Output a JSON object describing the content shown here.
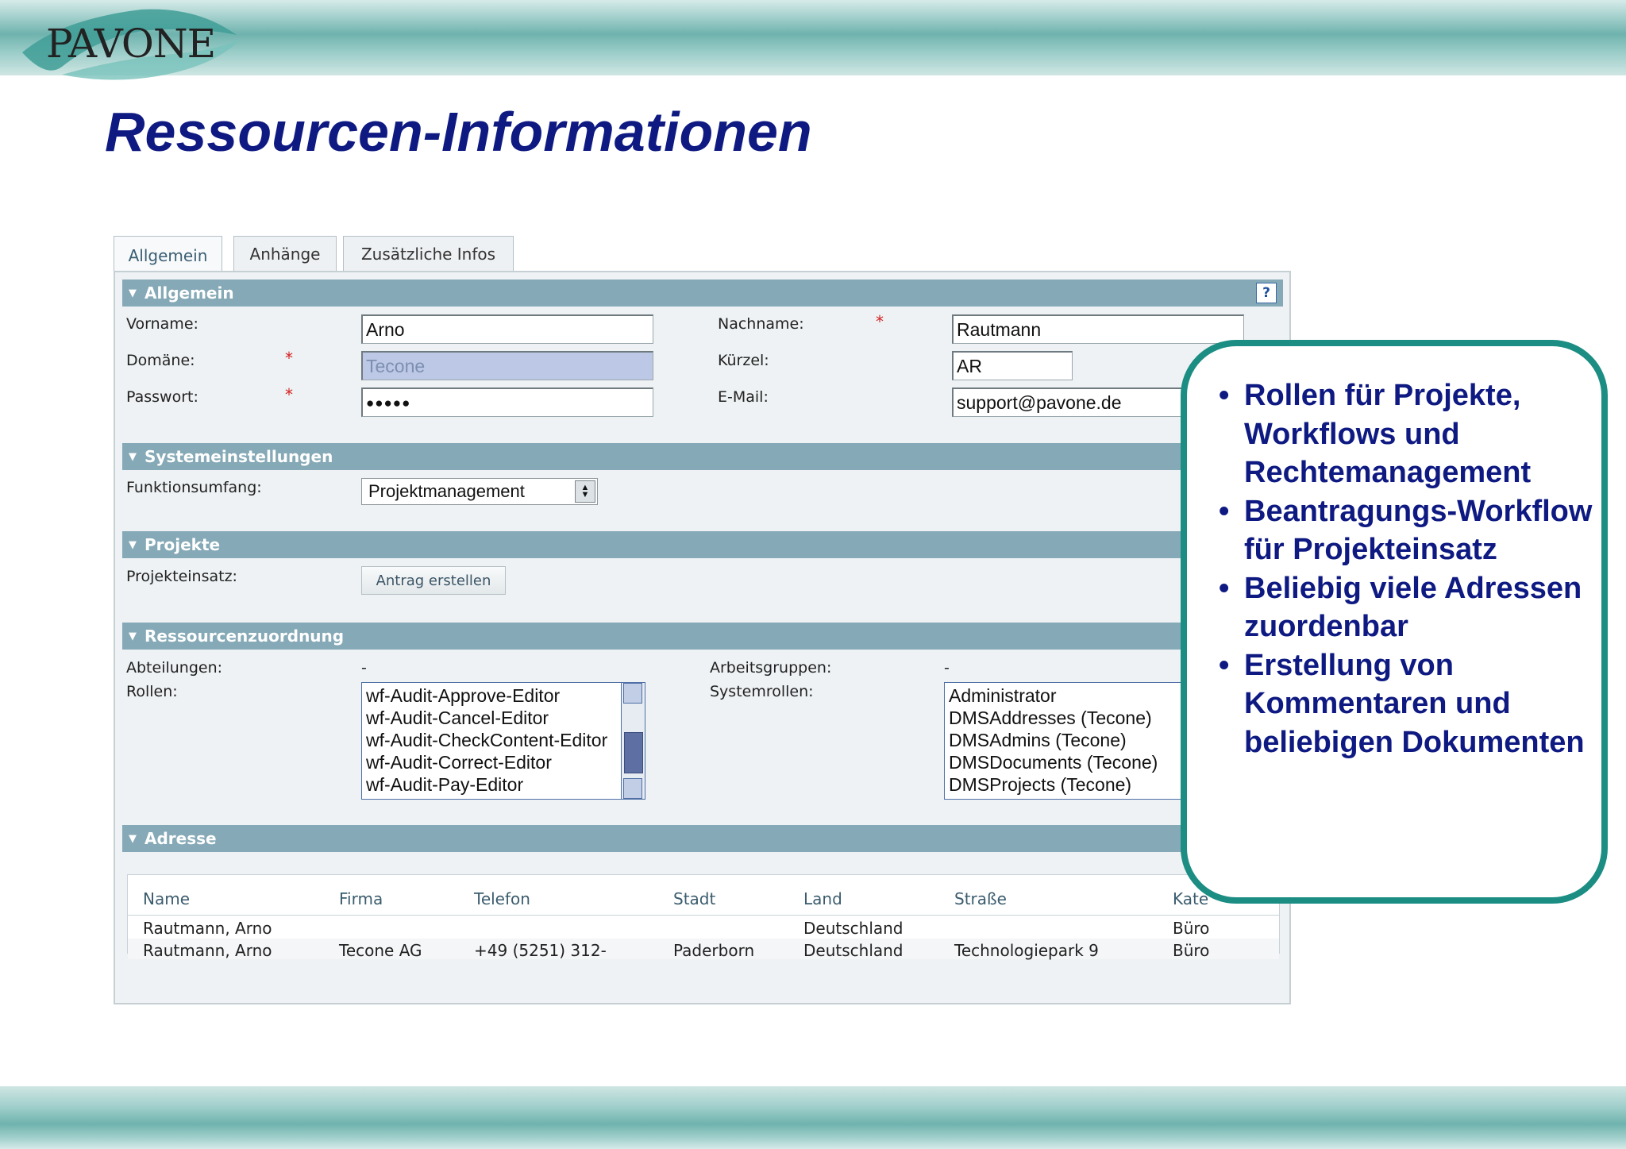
{
  "slide": {
    "logo_text": "PAVONE",
    "title": "Ressourcen-Informationen"
  },
  "tabs": [
    "Allgemein",
    "Anhänge",
    "Zusätzliche Infos"
  ],
  "help_label": "?",
  "sections": {
    "allgemein": "Allgemein",
    "system": "Systemeinstellungen",
    "projekte": "Projekte",
    "ressourcen": "Ressourcenzuordnung",
    "adresse": "Adresse"
  },
  "required_marker": "*",
  "fields": {
    "vorname": {
      "label": "Vorname:",
      "value": "Arno"
    },
    "nachname": {
      "label": "Nachname:",
      "value": "Rautmann"
    },
    "domaene": {
      "label": "Domäne:",
      "value": "Tecone"
    },
    "kuerzel": {
      "label": "Kürzel:",
      "value": "AR"
    },
    "passwort": {
      "label": "Passwort:",
      "value": "●●●●●"
    },
    "email": {
      "label": "E-Mail:",
      "value": "support@pavone.de"
    },
    "funktionsumfang": {
      "label": "Funktionsumfang:",
      "value": "Projektmanagement"
    },
    "projekteinsatz": {
      "label": "Projekteinsatz:",
      "button": "Antrag erstellen"
    },
    "abteilungen": {
      "label": "Abteilungen:",
      "value": "-"
    },
    "arbeitsgruppen": {
      "label": "Arbeitsgruppen:",
      "value": "-"
    },
    "rollen": {
      "label": "Rollen:"
    },
    "systemrollen": {
      "label": "Systemrollen:"
    }
  },
  "rollen_list": [
    "wf-Audit-Approve-Editor",
    "wf-Audit-Cancel-Editor",
    "wf-Audit-CheckContent-Editor",
    "wf-Audit-Correct-Editor",
    "wf-Audit-Pay-Editor"
  ],
  "systemrollen_list": [
    "Administrator",
    "DMSAddresses (Tecone)",
    "DMSAdmins (Tecone)",
    "DMSDocuments (Tecone)",
    "DMSProjects (Tecone)"
  ],
  "address_table": {
    "columns": [
      "Name",
      "Firma",
      "Telefon",
      "Stadt",
      "Land",
      "Straße",
      "Kate"
    ],
    "rows": [
      [
        "Rautmann, Arno",
        "",
        "",
        "",
        "Deutschland",
        "",
        "Büro"
      ],
      [
        "Rautmann, Arno",
        "Tecone AG",
        "+49 (5251) 312-",
        "Paderborn",
        "Deutschland",
        "Technologiepark 9",
        "Büro"
      ]
    ]
  },
  "callout": {
    "bullet": "•",
    "items": [
      "Rollen für Projekte, Workflows und Rechtemanagement",
      "Beantragungs-Workflow für Projekteinsatz",
      "Beliebig viele Adressen zuordenbar",
      "Erstellung von Kommentaren und beliebigen Dokumenten"
    ]
  }
}
